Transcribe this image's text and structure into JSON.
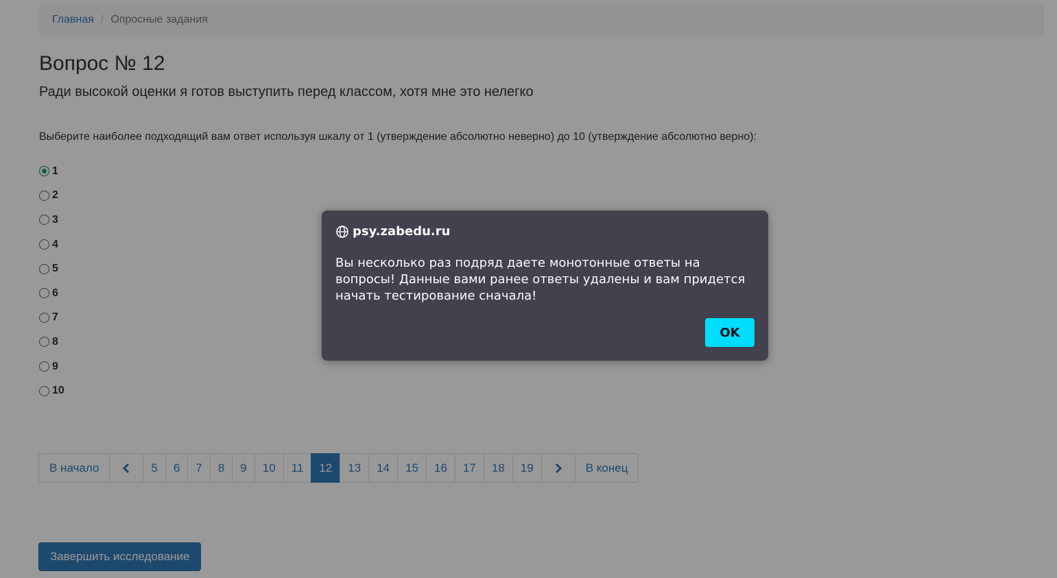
{
  "breadcrumb": {
    "home": "Главная",
    "separator": "/",
    "current": "Опросные задания"
  },
  "question": {
    "title": "Вопрос № 12",
    "text": "Ради высокой оценки я готов выступить перед классом, хотя мне это нелегко"
  },
  "instruction": "Выберите наиболее подходящий вам ответ используя шкалу от 1 (утверждение абсолютно неверно) до 10 (утверждение абсолютно верно):",
  "options": [
    "1",
    "2",
    "3",
    "4",
    "5",
    "6",
    "7",
    "8",
    "9",
    "10"
  ],
  "selected_option": "1",
  "pagination": {
    "first": "В начало",
    "last": "В конец",
    "prev_icon": "chevron-left-icon",
    "next_icon": "chevron-right-icon",
    "pages": [
      "5",
      "6",
      "7",
      "8",
      "9",
      "10",
      "11",
      "12",
      "13",
      "14",
      "15",
      "16",
      "17",
      "18",
      "19"
    ],
    "current": "12"
  },
  "finish_button": "Завершить исследование",
  "dialog": {
    "icon": "globe-icon",
    "site": "psy.zabedu.ru",
    "message": "Вы несколько раз подряд даете монотонные ответы на вопросы! Данные вами ранее ответы удалены и вам придется начать тестирование сначала!",
    "ok": "OK"
  },
  "colors": {
    "link": "#337ab7",
    "primary": "#337ab7",
    "dialog_bg": "#42414d",
    "ok_button": "#00ddff"
  }
}
